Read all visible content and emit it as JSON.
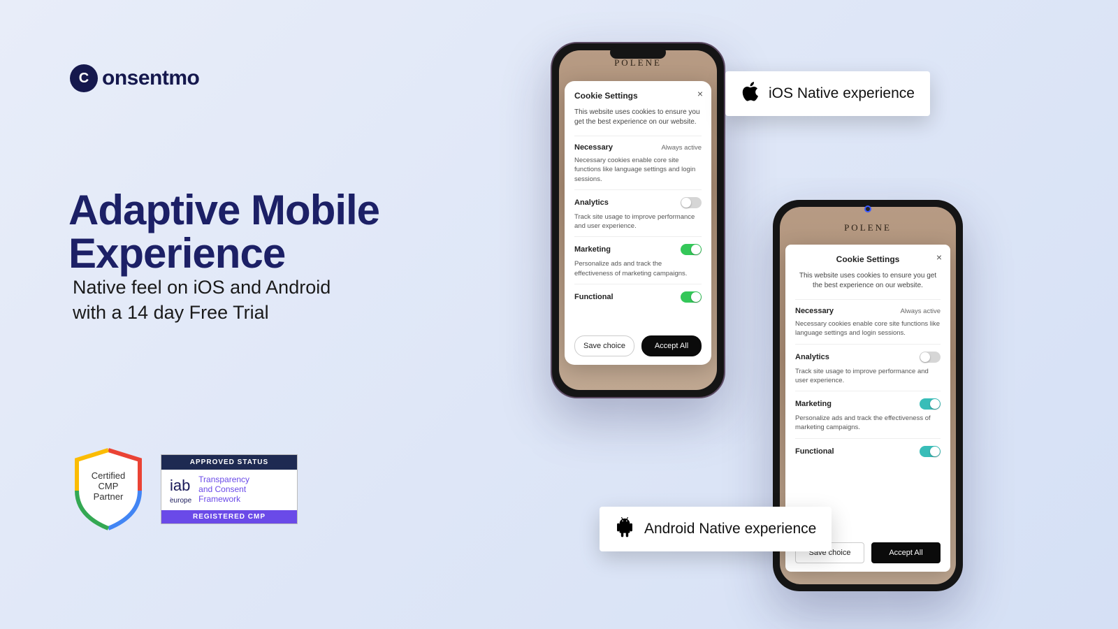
{
  "brand": {
    "name": "onsentmo",
    "mark": "C"
  },
  "headline": "Adaptive Mobile\nExperience",
  "subhead": "Native feel on iOS and Android\nwith a 14 day Free Trial",
  "phone_brand": "POLENE",
  "sheet": {
    "title": "Cookie Settings",
    "desc": "This website uses cookies to ensure you get the best experience on our website.",
    "always_active": "Always active",
    "save": "Save choice",
    "accept": "Accept All",
    "cats": [
      {
        "name": "Necessary",
        "desc": "Necessary cookies enable core site functions like language settings and login sessions.",
        "state": "always"
      },
      {
        "name": "Analytics",
        "desc": "Track site usage to improve performance and user experience.",
        "state": "off"
      },
      {
        "name": "Marketing",
        "desc": "Personalize ads and track the effectiveness of marketing campaigns.",
        "state": "on"
      },
      {
        "name": "Functional",
        "desc": "",
        "state": "on"
      }
    ]
  },
  "callouts": {
    "ios": "iOS Native experience",
    "android": "Android Native experience"
  },
  "badges": {
    "shield": "Certified\nCMP\nPartner",
    "iab_top": "APPROVED STATUS",
    "iab_logo": "iab",
    "iab_sub": "europe",
    "iab_mid": "Transparency\nand Consent\nFramework",
    "iab_bot": "REGISTERED CMP"
  }
}
